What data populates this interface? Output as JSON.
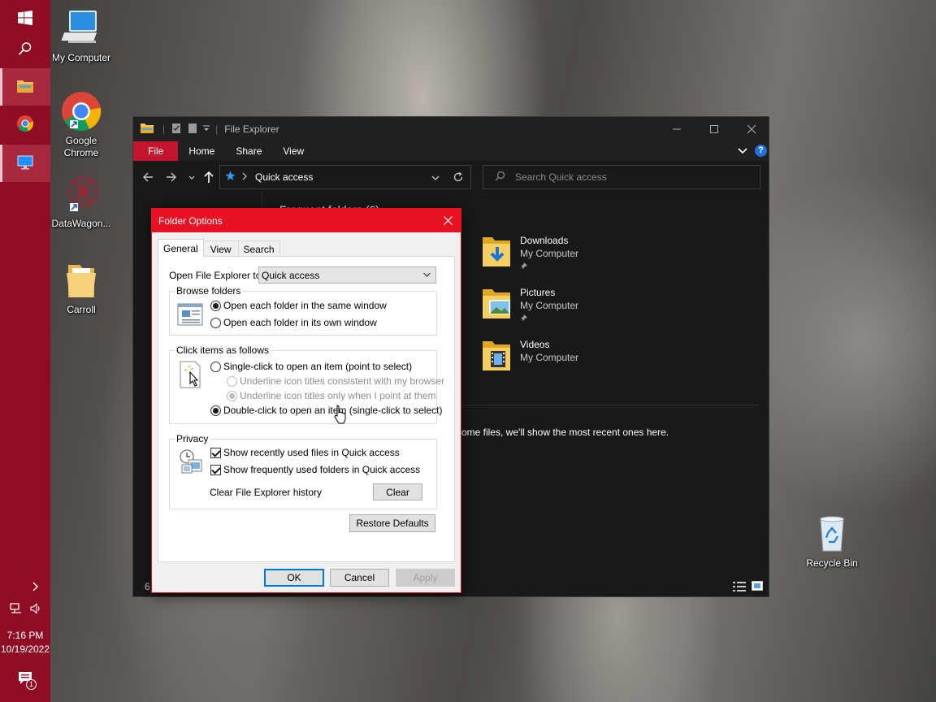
{
  "taskbar": {
    "clock_time": "7:16 PM",
    "clock_date": "10/19/2022",
    "notification_count": "1"
  },
  "desktop": {
    "icons": [
      {
        "label": "My Computer"
      },
      {
        "label": "Google Chrome"
      },
      {
        "label": "DataWagon..."
      },
      {
        "label": "Carroll"
      },
      {
        "label": "Recycle Bin"
      }
    ]
  },
  "explorer": {
    "title": "File Explorer",
    "ribbon_tabs": [
      "File",
      "Home",
      "Share",
      "View"
    ],
    "address": "Quick access",
    "search_placeholder": "Search Quick access",
    "section_title": "Frequent folders (6)",
    "folders": [
      {
        "name": "Downloads",
        "location": "My Computer"
      },
      {
        "name": "Pictures",
        "location": "My Computer"
      },
      {
        "name": "Videos",
        "location": "My Computer"
      }
    ],
    "recent_message": "ome files, we'll show the most recent ones here.",
    "status_count": "6"
  },
  "dialog": {
    "title": "Folder Options",
    "tabs": [
      "General",
      "View",
      "Search"
    ],
    "open_to_label": "Open File Explorer to:",
    "open_to_value": "Quick access",
    "browse_folders": {
      "title": "Browse folders",
      "same_window": "Open each folder in the same window",
      "own_window": "Open each folder in its own window"
    },
    "click_items": {
      "title": "Click items as follows",
      "single_click": "Single-click to open an item (point to select)",
      "underline_browser": "Underline icon titles consistent with my browser",
      "underline_point": "Underline icon titles only when I point at them",
      "double_click": "Double-click to open an item (single-click to select)"
    },
    "privacy": {
      "title": "Privacy",
      "recent_files": "Show recently used files in Quick access",
      "frequent_folders": "Show frequently used folders in Quick access",
      "clear_history_label": "Clear File Explorer history",
      "clear_button": "Clear"
    },
    "restore_defaults": "Restore Defaults",
    "ok": "OK",
    "cancel": "Cancel",
    "apply": "Apply"
  }
}
